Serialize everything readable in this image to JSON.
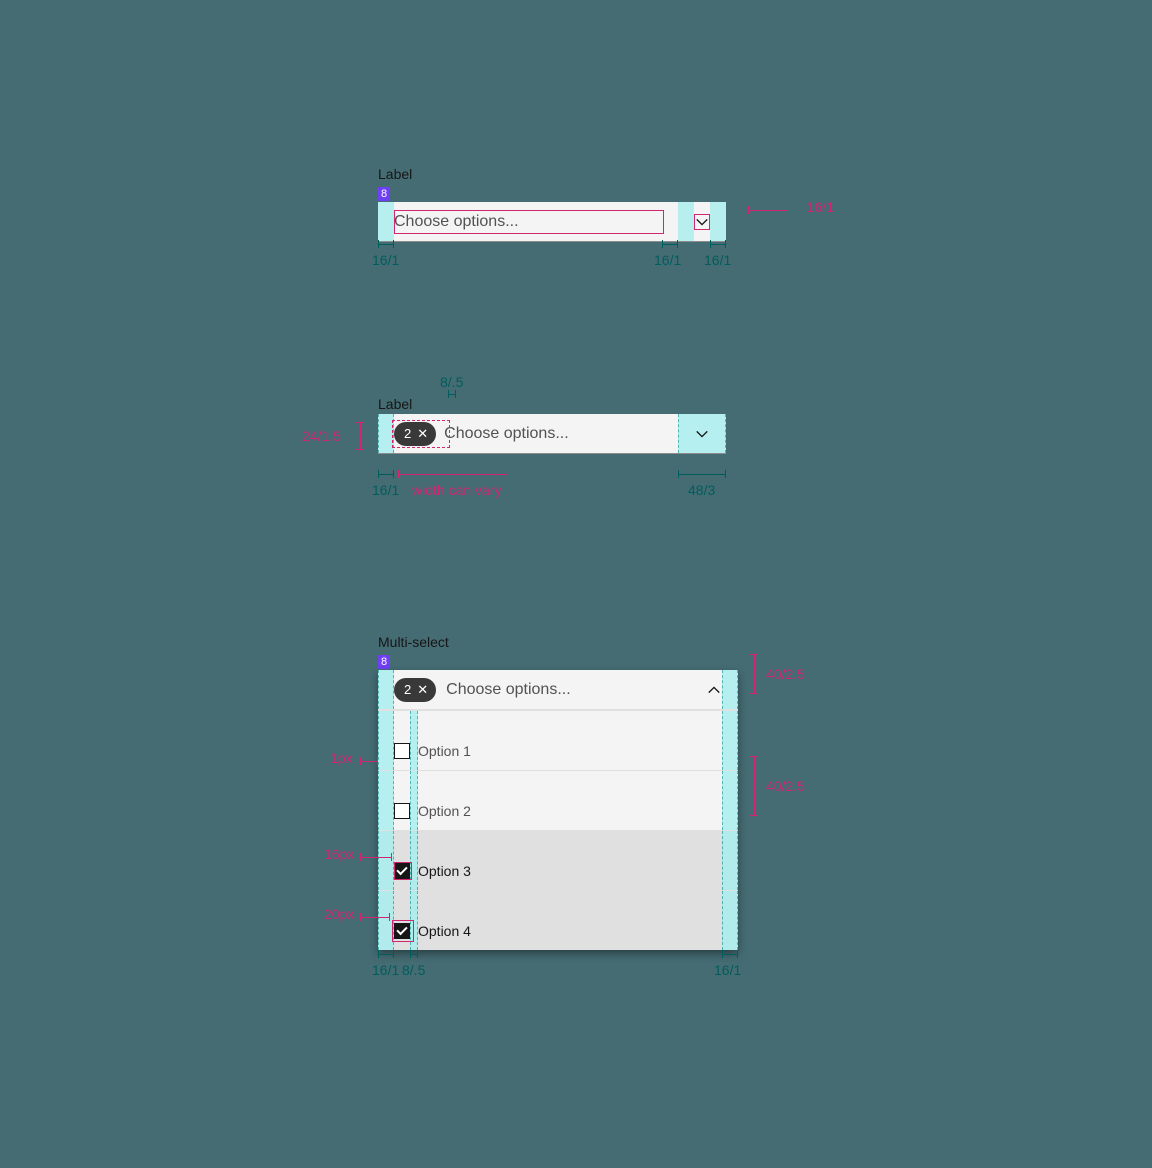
{
  "colors": {
    "teal": "#005d5d",
    "magenta": "#d12771",
    "tint": "#a7eeee",
    "purple": "#6f3ff5"
  },
  "spec1": {
    "label": "Label",
    "gap_badge": "8",
    "placeholder": "Choose options...",
    "icon_spec": "16/1",
    "measures": {
      "left": "16/1",
      "right_gap": "16/1",
      "right_pad": "16/1"
    }
  },
  "spec2": {
    "label": "Label",
    "top_gap": "8/.5",
    "tag_count": "2",
    "placeholder": "Choose options...",
    "pill_h": "24/1.5",
    "left": "16/1",
    "width_note": "width can vary",
    "right": "48/3"
  },
  "spec3": {
    "label": "Multi-select",
    "gap_badge": "8",
    "tag_count": "2",
    "placeholder": "Choose options...",
    "header_h": "40/2.5",
    "row_h": "40/2.5",
    "divider": "1px",
    "cb_size": "16px",
    "cb_hit": "20px",
    "left": "16/1",
    "inner_gap": "8/.5",
    "right": "16/1",
    "options": [
      {
        "label": "Option 1",
        "checked": false
      },
      {
        "label": "Option 2",
        "checked": false
      },
      {
        "label": "Option 3",
        "checked": true
      },
      {
        "label": "Option 4",
        "checked": true
      }
    ]
  }
}
